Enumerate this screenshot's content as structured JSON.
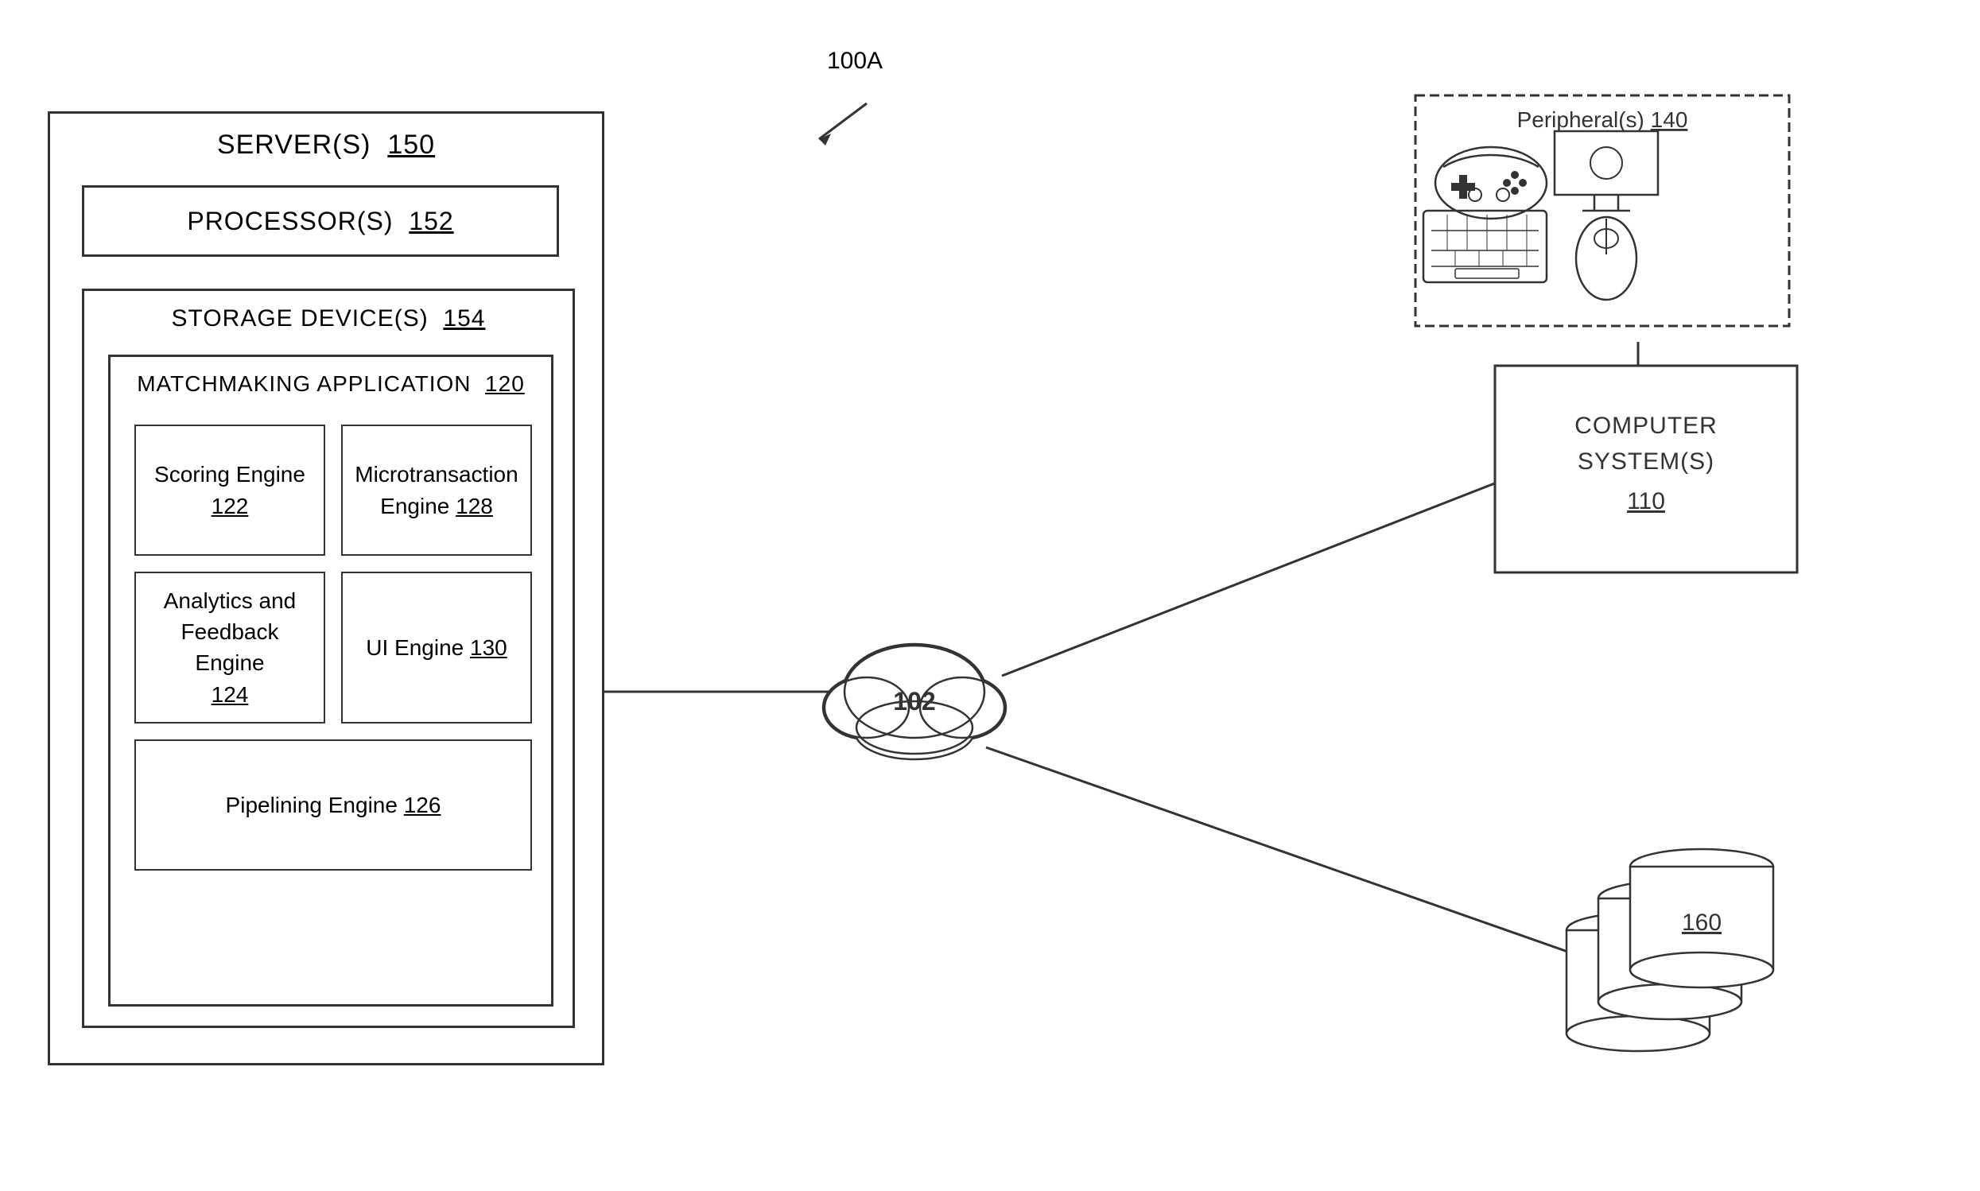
{
  "diagram": {
    "ref_label": "100A",
    "server": {
      "label": "SERVER(S)",
      "ref": "150"
    },
    "processor": {
      "label": "PROCESSOR(S)",
      "ref": "152"
    },
    "storage": {
      "label": "STORAGE DEVICE(S)",
      "ref": "154"
    },
    "matchmaking": {
      "label": "MATCHMAKING APPLICATION",
      "ref": "120"
    },
    "engines": [
      {
        "id": "scoring",
        "label": "Scoring Engine",
        "ref": "122",
        "wide": false
      },
      {
        "id": "microtransaction",
        "label": "Microtransaction Engine",
        "ref": "128",
        "wide": false
      },
      {
        "id": "analytics",
        "label": "Analytics and Feedback Engine",
        "ref": "124",
        "wide": false
      },
      {
        "id": "ui",
        "label": "UI Engine",
        "ref": "130",
        "wide": false
      },
      {
        "id": "pipelining",
        "label": "Pipelining Engine",
        "ref": "126",
        "wide": true
      }
    ],
    "network": {
      "ref": "102"
    },
    "computer": {
      "label": "COMPUTER\nSYSTEM(S)",
      "ref": "110"
    },
    "peripheral": {
      "label": "Peripheral(s)",
      "ref": "140"
    },
    "database": {
      "ref": "160"
    }
  }
}
